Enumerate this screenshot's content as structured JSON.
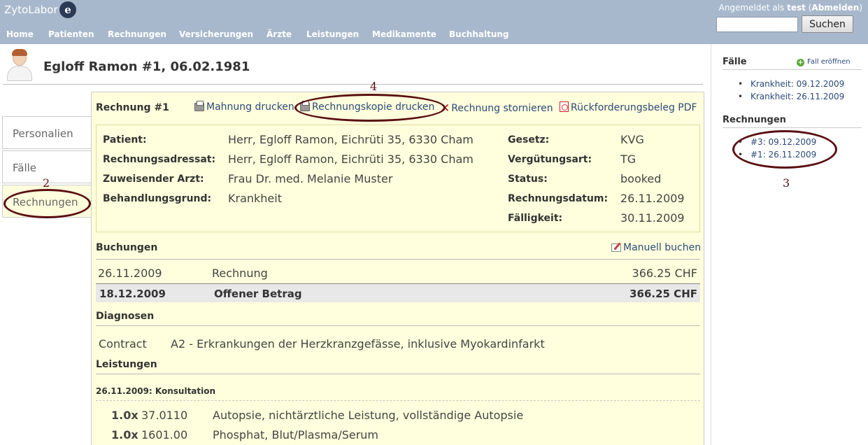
{
  "header": {
    "brand": "ZytoLabor",
    "brand_logo": "e",
    "logged_in_prefix": "Angemeldet als",
    "username": "test",
    "logout": "Abmelden",
    "search_value": "",
    "search_button": "Suchen"
  },
  "nav": [
    "Home",
    "Patienten",
    "Rechnungen",
    "Versicherungen",
    "Ärzte",
    "Leistungen",
    "Medikamente",
    "Buchhaltung"
  ],
  "patient": {
    "title": "Egloff Ramon #1, 06.02.1981"
  },
  "tabs": [
    "Personalien",
    "Fälle",
    "Rechnungen"
  ],
  "invoice": {
    "title": "Rechnung #1",
    "actions": {
      "reminder": "Mahnung drucken",
      "copy": "Rechnungskopie drucken",
      "cancel": "Rechnung stornieren",
      "refund_pdf": "Rückforderungsbeleg PDF"
    },
    "info_left": [
      {
        "label": "Patient:",
        "value": "Herr, Egloff Ramon, Eichrüti 35, 6330 Cham"
      },
      {
        "label": "Rechnungsadressat:",
        "value": "Herr, Egloff Ramon, Eichrüti 35, 6330 Cham"
      },
      {
        "label": "Zuweisender Arzt:",
        "value": "Frau Dr. med. Melanie Muster"
      },
      {
        "label": "Behandlungsgrund:",
        "value": "Krankheit"
      }
    ],
    "info_right": [
      {
        "label": "Gesetz:",
        "value": "KVG"
      },
      {
        "label": "Vergütungsart:",
        "value": "TG"
      },
      {
        "label": "Status:",
        "value": "booked"
      },
      {
        "label": "Rechnungsdatum:",
        "value": "26.11.2009"
      },
      {
        "label": "Fälligkeit:",
        "value": "30.11.2009"
      }
    ]
  },
  "bookings": {
    "title": "Buchungen",
    "manual_link": "Manuell buchen",
    "rows": [
      {
        "date": "26.11.2009",
        "text": "Rechnung",
        "amount": "366.25 CHF"
      }
    ],
    "total": {
      "date": "18.12.2009",
      "text": "Offener Betrag",
      "amount": "366.25 CHF"
    }
  },
  "diagnoses": {
    "title": "Diagnosen",
    "rows": [
      {
        "type": "Contract",
        "text": "A2 - Erkrankungen der Herzkranzgefässe, inklusive Myokardinfarkt"
      }
    ]
  },
  "services": {
    "title": "Leistungen",
    "group": "26.11.2009: Konsultation",
    "rows": [
      {
        "qty": "1.0x",
        "code": "37.0110",
        "text": "Autopsie, nichtärztliche Leistung, vollständige Autopsie"
      },
      {
        "qty": "1.0x",
        "code": "1601.00",
        "text": "Phosphat, Blut/Plasma/Serum"
      }
    ]
  },
  "sidebar": {
    "cases_title": "Fälle",
    "open_case": "Fall eröffnen",
    "cases": [
      "Krankheit: 09.12.2009",
      "Krankheit: 26.11.2009"
    ],
    "invoices_title": "Rechnungen",
    "invoices": [
      "#3: 09.12.2009",
      "#1: 26.11.2009"
    ]
  },
  "annotations": [
    "2",
    "3",
    "4"
  ]
}
